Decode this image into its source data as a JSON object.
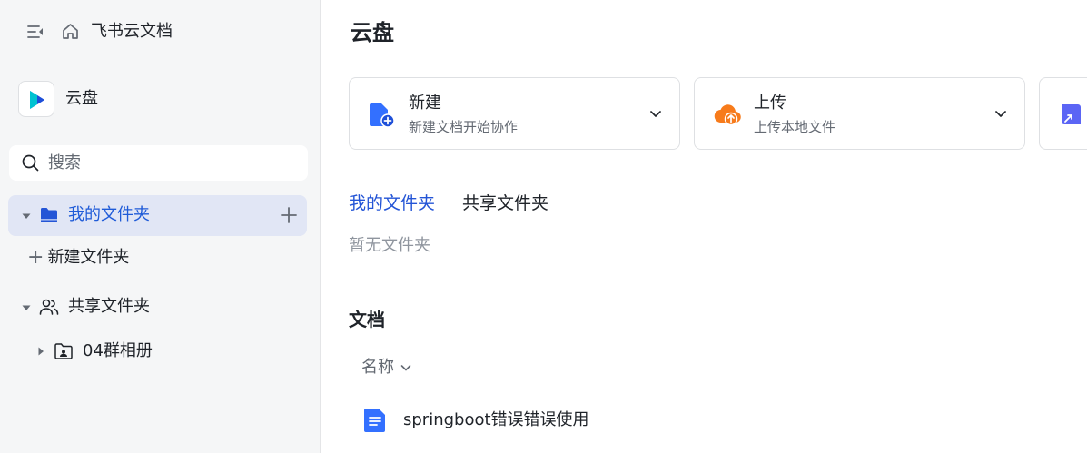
{
  "topbar": {
    "breadcrumb": "飞书云文档",
    "icons": [
      "collapse-sidebar-icon",
      "home-icon"
    ]
  },
  "space": {
    "name": "云盘",
    "icon": "drive-logo-icon"
  },
  "search": {
    "placeholder": "搜索"
  },
  "tree": {
    "my_folders": {
      "label": "我的文件夹",
      "expanded": true,
      "selected": true
    },
    "new_folder": {
      "label": "新建文件夹"
    },
    "shared_folders": {
      "label": "共享文件夹",
      "expanded": true
    },
    "shared_children": [
      {
        "label": "04群相册",
        "expanded": false
      }
    ]
  },
  "main": {
    "title": "云盘",
    "cards": [
      {
        "title": "新建",
        "subtitle": "新建文档开始协作",
        "icon": "new-doc-icon"
      },
      {
        "title": "上传",
        "subtitle": "上传本地文件",
        "icon": "upload-cloud-icon"
      }
    ],
    "tabs": [
      {
        "label": "我的文件夹",
        "active": true
      },
      {
        "label": "共享文件夹",
        "active": false
      }
    ],
    "empty_text": "暂无文件夹",
    "docs_title": "文档",
    "sort_label": "名称",
    "documents": [
      {
        "name": "springboot错误错误使用",
        "icon": "doc-icon"
      }
    ]
  },
  "colors": {
    "accent": "#2455d6",
    "sidebar_bg": "#f5f6f7",
    "selected_bg": "#e1e6f5",
    "upload_orange": "#f77b1b"
  }
}
